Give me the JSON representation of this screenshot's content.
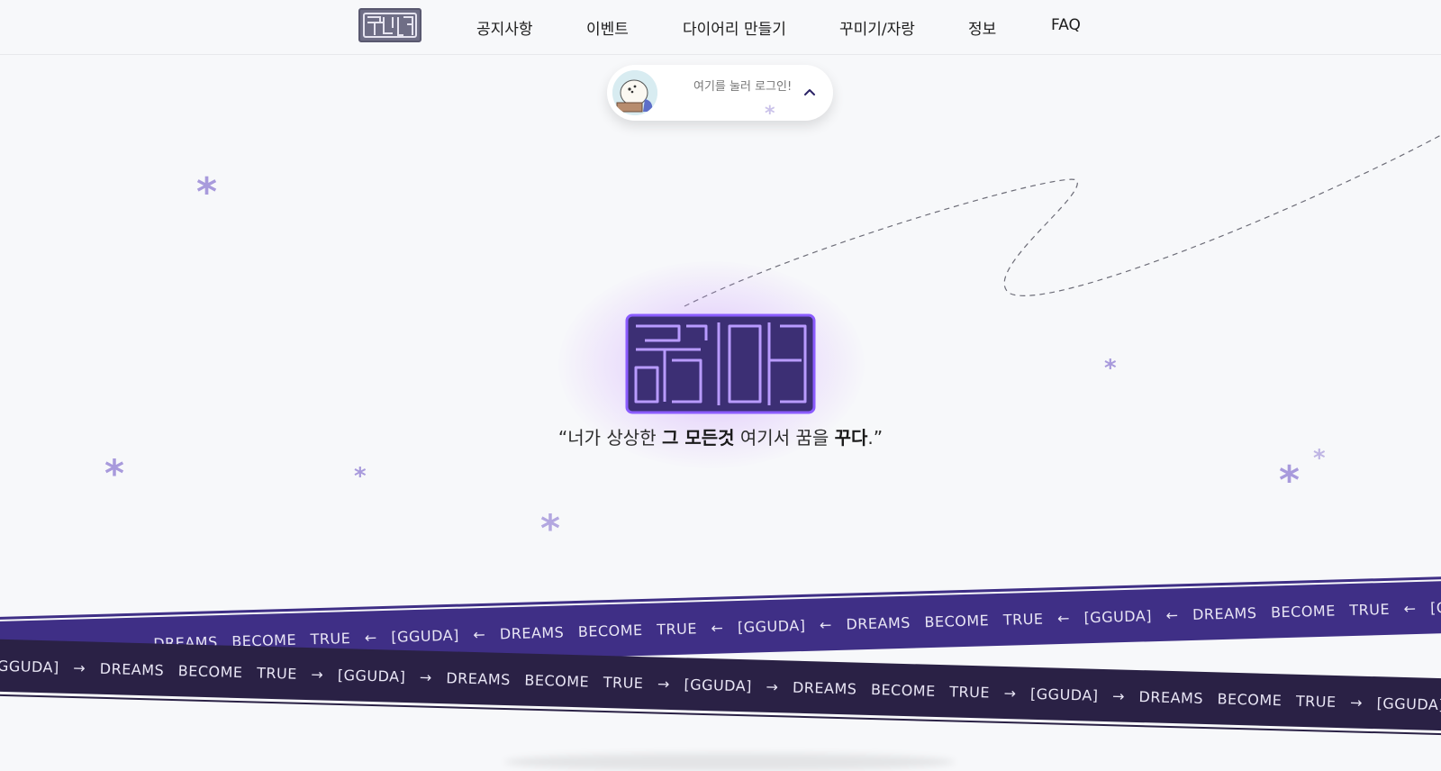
{
  "nav": {
    "logo_alt": "꾸다",
    "items": [
      {
        "label": "공지사항"
      },
      {
        "label": "이벤트"
      },
      {
        "label": "다이어리 만들기"
      },
      {
        "label": "꾸미기/자랑"
      },
      {
        "label": "정보"
      },
      {
        "label": "FAQ"
      }
    ]
  },
  "login": {
    "prompt": "여기를 눌러 로그인!",
    "icon": "chevron-up-icon"
  },
  "hero": {
    "logo_text": "꾸다",
    "tagline": {
      "open_quote": "“",
      "part1": "너가 상상한 ",
      "bold1": "그 모든것",
      "part2": " 여기서 꿈을 ",
      "bold2": "꾸다",
      "end": ".”"
    }
  },
  "ribbons": {
    "top_text": "DREAMS BECOME TRUE ← [GGUDA] ← DREAMS BECOME TRUE ← [GGUDA] ← DREAMS BECOME TRUE ← [GGUDA] ← DREAMS BECOME TRUE ← [GGUDA] ← DREAMS BECOME TRUE ← [GGUDA] ← DREAMS BECOME TRUE ← [GGUDA] ← DREA",
    "bottom_text": "[GGUDA] → DREAMS BECOME TRUE → [GGUDA] → DREAMS BECOME TRUE → [GGUDA] → DREAMS BECOME TRUE → [GGUDA] → DREAMS BECOME TRUE → [GGUDA] → DREAMS BECOME TRUE → [GGUDA] → DREAMS BECO"
  },
  "colors": {
    "accent": "#6a3fd6",
    "ribbon_top": "#3f2f86",
    "ribbon_bottom": "#2a2145",
    "sparkle": "#a89adc"
  }
}
